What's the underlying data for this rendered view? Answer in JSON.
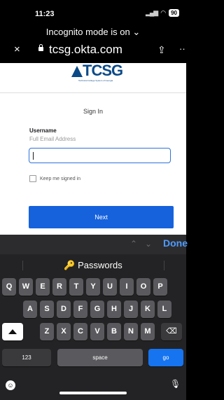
{
  "status": {
    "time": "11:23",
    "battery": "90"
  },
  "browser": {
    "banner": "Incognito mode is on ⌄",
    "url": "tcsg.okta.com",
    "close_glyph": "×",
    "share_glyph": "⇪",
    "more_glyph": "··"
  },
  "page": {
    "logo_text": "TCSG",
    "logo_tagline": "Technical College System of Georgia",
    "signin_title": "Sign In",
    "username_label": "Username",
    "username_hint": "Full Email Address",
    "username_value": "",
    "keep_signed_in": "Keep me signed in",
    "next_button": "Next"
  },
  "keyboard": {
    "up_arrow": "⌃",
    "down_arrow": "⌄",
    "done": "Done",
    "passwords": "Passwords",
    "rows": [
      [
        "Q",
        "W",
        "E",
        "R",
        "T",
        "Y",
        "U",
        "I",
        "O",
        "P"
      ],
      [
        "A",
        "S",
        "D",
        "F",
        "G",
        "H",
        "J",
        "K",
        "L"
      ],
      [
        "Z",
        "X",
        "C",
        "V",
        "B",
        "N",
        "M"
      ]
    ],
    "numbers_key": "123",
    "space_key": "space",
    "go_key": "go",
    "delete_glyph": "⌫",
    "emoji_glyph": "☺",
    "mic_glyph": "🎙"
  },
  "colors": {
    "accent": "#1662dd",
    "done": "#4f9bff",
    "brand": "#0b4a88"
  }
}
